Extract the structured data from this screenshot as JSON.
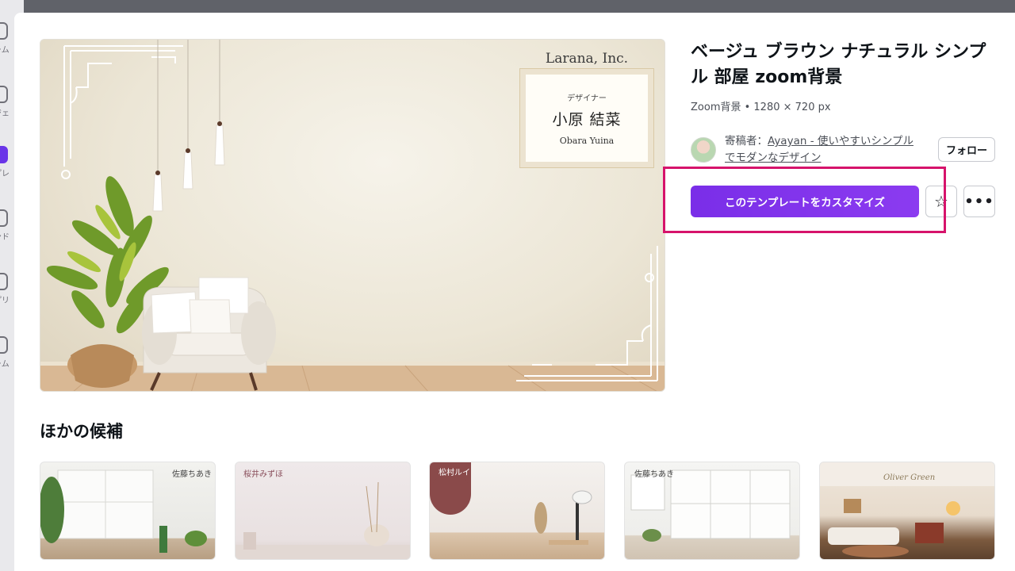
{
  "rail": {
    "items": [
      {
        "label": "ーム",
        "icon": "home-icon"
      },
      {
        "label": "ジェ",
        "icon": "folder-icon"
      },
      {
        "label": "プレ",
        "icon": "template-icon"
      },
      {
        "label": "ンド",
        "icon": "brand-icon"
      },
      {
        "label": "プリ",
        "icon": "apps-icon"
      },
      {
        "label": "ーム",
        "icon": "magic-icon"
      }
    ]
  },
  "preview": {
    "company": "Larana, Inc.",
    "role": "デザイナー",
    "name": "小原 結菜",
    "roman_name": "Obara Yuina"
  },
  "details": {
    "title": "ベージュ ブラウン ナチュラル シンプル 部屋 zoom背景",
    "subtitle": "Zoom背景 • 1280 × 720 px",
    "contributor_prefix": "寄稿者：",
    "contributor_name": "Ayayan - 使いやすいシンプルでモダンなデザイン",
    "follow_label": "フォロー",
    "customize_label": "このテンプレートをカスタマイズ",
    "star_icon": "☆",
    "more_icon": "•••"
  },
  "other": {
    "heading": "ほかの候補",
    "thumbnails": [
      {
        "label": "佐藤ちあき"
      },
      {
        "label": "桜井みずほ"
      },
      {
        "label": "松村ルイ"
      },
      {
        "label": "佐藤ちあき"
      },
      {
        "label": "Oliver Green"
      }
    ]
  },
  "colors": {
    "accent": "#7d2ae8",
    "highlight": "#d6136b"
  }
}
